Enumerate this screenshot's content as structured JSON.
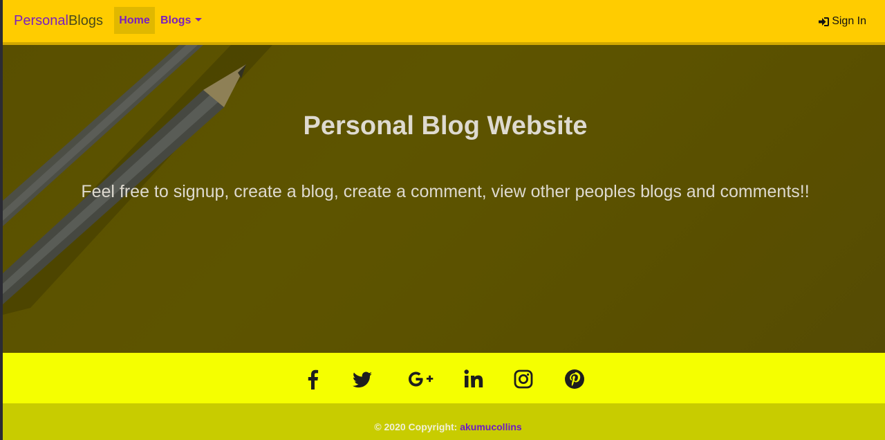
{
  "navbar": {
    "brand_part1": "Personal",
    "brand_part2": "Blogs",
    "home_label": "Home",
    "blogs_label": "Blogs",
    "signin_label": "Sign In"
  },
  "hero": {
    "title": "Personal Blog Website",
    "subtitle": "Feel free to signup, create a blog, create a comment, view other peoples blogs and comments!!"
  },
  "social": {
    "icons": [
      "facebook-icon",
      "twitter-icon",
      "google-plus-icon",
      "linkedin-icon",
      "instagram-icon",
      "pinterest-icon"
    ]
  },
  "footer": {
    "copyright_text": "© 2020 Copyright: ",
    "copyright_link": "akumucollins"
  },
  "colors": {
    "navbar_bg": "#ffcc00",
    "brand_accent": "#7a1fbf",
    "social_bar_bg": "#f5ff00",
    "footer_bg": "#c8cc00"
  }
}
